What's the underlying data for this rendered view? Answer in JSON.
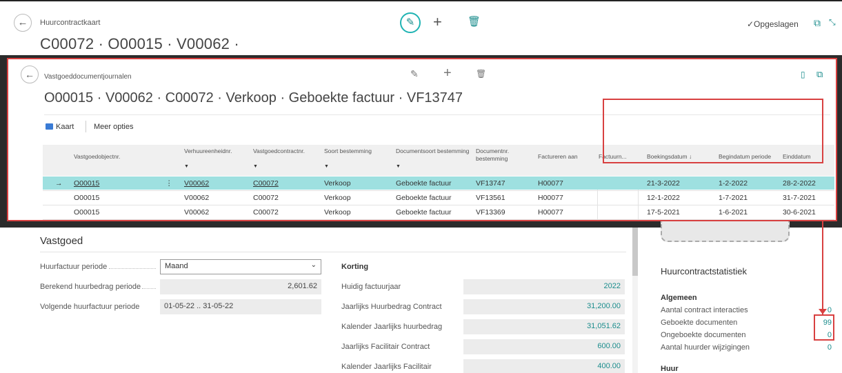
{
  "outer": {
    "breadcrumb": "Huurcontractkaart",
    "title": "C00072 · O00015 · V00062 ·",
    "saved": "✓Opgeslagen"
  },
  "lookup": {
    "breadcrumb": "Vastgoeddocumentjournalen",
    "title": "O00015 · V00062 · C00072 · Verkoop · Geboekte factuur · VF13747",
    "action_kaart": "Kaart",
    "action_more": "Meer opties",
    "columns": [
      {
        "label": "Vastgoedobjectnr.",
        "filter": false
      },
      {
        "label": "Verhuureenheidnr.",
        "filter": true
      },
      {
        "label": "Vastgoedcontractnr.",
        "filter": true
      },
      {
        "label": "Soort bestemming",
        "filter": true
      },
      {
        "label": "Documentsoort bestemming",
        "filter": true
      },
      {
        "label": "Documentnr. bestemming",
        "filter": false
      },
      {
        "label": "Factureren aan",
        "filter": false
      },
      {
        "label": "Factuurn...",
        "filter": false
      },
      {
        "label": "Boekingsdatum ↓",
        "filter": false
      },
      {
        "label": "Begindatum periode",
        "filter": false
      },
      {
        "label": "Einddatum",
        "filter": false
      }
    ],
    "rows": [
      {
        "object": "O00015",
        "unit": "V00062",
        "contract": "C00072",
        "type": "Verkoop",
        "doctype": "Geboekte factuur",
        "docnr": "VF13747",
        "bill_to": "H00077",
        "posting": "21-3-2022",
        "start": "1-2-2022",
        "end": "28-2-2022"
      },
      {
        "object": "O00015",
        "unit": "V00062",
        "contract": "C00072",
        "type": "Verkoop",
        "doctype": "Geboekte factuur",
        "docnr": "VF13561",
        "bill_to": "H00077",
        "posting": "12-1-2022",
        "start": "1-7-2021",
        "end": "31-7-2021"
      },
      {
        "object": "O00015",
        "unit": "V00062",
        "contract": "C00072",
        "type": "Verkoop",
        "doctype": "Geboekte factuur",
        "docnr": "VF13369",
        "bill_to": "H00077",
        "posting": "17-5-2021",
        "start": "1-6-2021",
        "end": "30-6-2021"
      }
    ]
  },
  "vastgoed": {
    "heading": "Vastgoed",
    "period_label": "Huurfactuur periode",
    "period_value": "Maand",
    "calc_label": "Berekend huurbedrag periode",
    "calc_value": "2,601.62",
    "next_label": "Volgende huurfactuur periode",
    "next_value": "01-05-22 .. 31-05-22",
    "korting": "Korting",
    "fields": [
      {
        "label": "Huidig factuurjaar",
        "value": "2022"
      },
      {
        "label": "Jaarlijks Huurbedrag Contract",
        "value": "31,200.00"
      },
      {
        "label": "Kalender Jaarlijks huurbedrag",
        "value": "31,051.62"
      },
      {
        "label": "Jaarlijks Facilitair Contract",
        "value": "600.00"
      },
      {
        "label": "Kalender Jaarlijks Facilitair",
        "value": "400.00"
      }
    ]
  },
  "stats": {
    "title": "Huurcontractstatistiek",
    "section_general": "Algemeen",
    "items": [
      {
        "label": "Aantal contract interacties",
        "value": "0"
      },
      {
        "label": "Geboekte documenten",
        "value": "99"
      },
      {
        "label": "Ongeboekte documenten",
        "value": "0"
      },
      {
        "label": "Aantal huurder wijzigingen",
        "value": "0"
      }
    ],
    "section_rent": "Huur"
  },
  "colors": {
    "accent": "#1a8c8c",
    "selected_row": "#9ee0e0",
    "highlight": "#d84040"
  }
}
